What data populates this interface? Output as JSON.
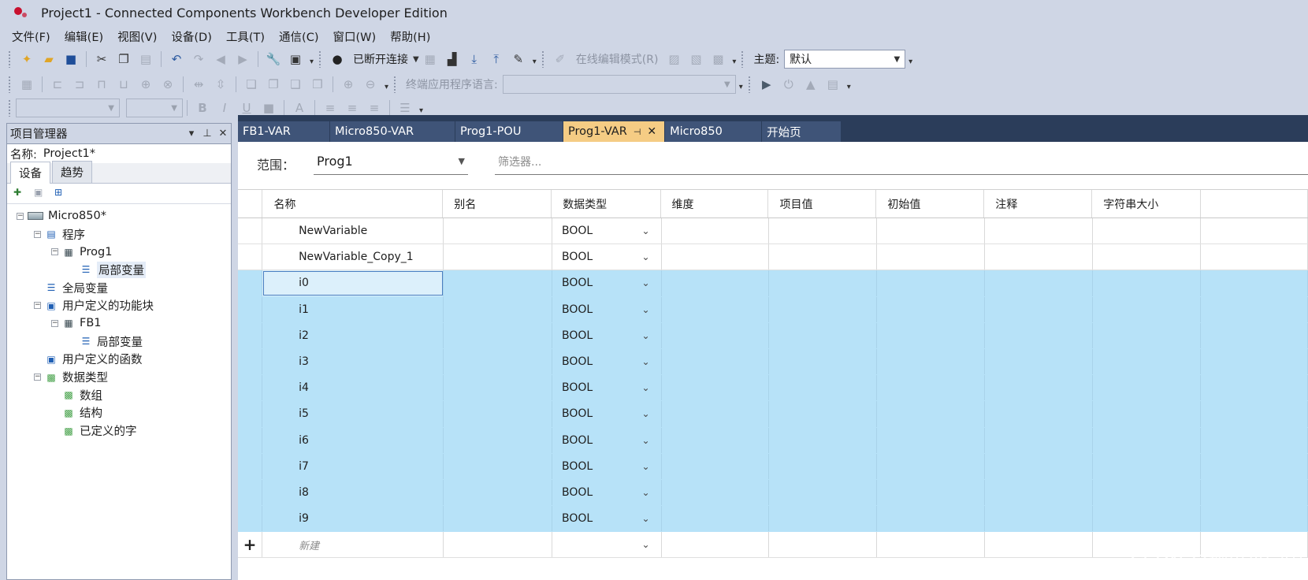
{
  "window": {
    "title": "Project1 - Connected Components Workbench Developer Edition"
  },
  "menu": [
    "文件(F)",
    "编辑(E)",
    "视图(V)",
    "设备(D)",
    "工具(T)",
    "通信(C)",
    "窗口(W)",
    "帮助(H)"
  ],
  "toolbar": {
    "connection_status": "已断开连接",
    "online_edit_label": "在线编辑模式(R)",
    "theme_label": "主题:",
    "theme_value": "默认",
    "terminal_lang_label": "终端应用程序语言:"
  },
  "project_panel": {
    "title": "项目管理器",
    "name_label": "名称:",
    "name_value": "Project1*",
    "tabs": [
      "设备",
      "趋势"
    ],
    "tree": [
      {
        "label": "Micro850*",
        "level": 0,
        "expander": "−",
        "icon": "controller-icon"
      },
      {
        "label": "程序",
        "level": 1,
        "expander": "−",
        "icon": "program-folder-icon"
      },
      {
        "label": "Prog1",
        "level": 2,
        "expander": "−",
        "icon": "program-icon"
      },
      {
        "label": "局部变量",
        "level": 3,
        "expander": "",
        "icon": "variable-list-icon"
      },
      {
        "label": "全局变量",
        "level": 1,
        "expander": "",
        "icon": "variable-list-icon"
      },
      {
        "label": "用户定义的功能块",
        "level": 1,
        "expander": "−",
        "icon": "function-block-folder-icon"
      },
      {
        "label": "FB1",
        "level": 2,
        "expander": "−",
        "icon": "program-icon"
      },
      {
        "label": "局部变量",
        "level": 3,
        "expander": "",
        "icon": "variable-list-icon"
      },
      {
        "label": "用户定义的函数",
        "level": 1,
        "expander": "",
        "icon": "function-icon"
      },
      {
        "label": "数据类型",
        "level": 1,
        "expander": "−",
        "icon": "data-type-icon"
      },
      {
        "label": "数组",
        "level": 2,
        "expander": "",
        "icon": "data-type-icon"
      },
      {
        "label": "结构",
        "level": 2,
        "expander": "",
        "icon": "data-type-icon"
      },
      {
        "label": "已定义的字",
        "level": 2,
        "expander": "",
        "icon": "data-type-icon"
      }
    ]
  },
  "doc_tabs": [
    {
      "label": "FB1-VAR",
      "active": false
    },
    {
      "label": "Micro850-VAR",
      "active": false
    },
    {
      "label": "Prog1-POU",
      "active": false
    },
    {
      "label": "Prog1-VAR",
      "active": true
    },
    {
      "label": "Micro850",
      "active": false
    },
    {
      "label": "开始页",
      "active": false
    }
  ],
  "variables_view": {
    "scope_label": "范围：",
    "scope_value": "Prog1",
    "filter_placeholder": "筛选器...",
    "columns": [
      "名称",
      "别名",
      "数据类型",
      "维度",
      "项目值",
      "初始值",
      "注释",
      "字符串大小"
    ],
    "rows": [
      {
        "name": "NewVariable",
        "type": "BOOL",
        "selected": false
      },
      {
        "name": "NewVariable_Copy_1",
        "type": "BOOL",
        "selected": false
      },
      {
        "name": "i0",
        "type": "BOOL",
        "selected": true
      },
      {
        "name": "i1",
        "type": "BOOL",
        "selected": true
      },
      {
        "name": "i2",
        "type": "BOOL",
        "selected": true
      },
      {
        "name": "i3",
        "type": "BOOL",
        "selected": true
      },
      {
        "name": "i4",
        "type": "BOOL",
        "selected": true
      },
      {
        "name": "i5",
        "type": "BOOL",
        "selected": true
      },
      {
        "name": "i6",
        "type": "BOOL",
        "selected": true
      },
      {
        "name": "i7",
        "type": "BOOL",
        "selected": true
      },
      {
        "name": "i8",
        "type": "BOOL",
        "selected": true
      },
      {
        "name": "i9",
        "type": "BOOL",
        "selected": true
      }
    ],
    "new_row_placeholder": "新建",
    "add_symbol": "+"
  },
  "watermark": "CSDN @控界小宇宙",
  "colors": {
    "selection": "#b7e2f8",
    "active_tab": "#f5cc84",
    "doc_background": "#2b3d5a",
    "chrome": "#cfd6e5"
  }
}
